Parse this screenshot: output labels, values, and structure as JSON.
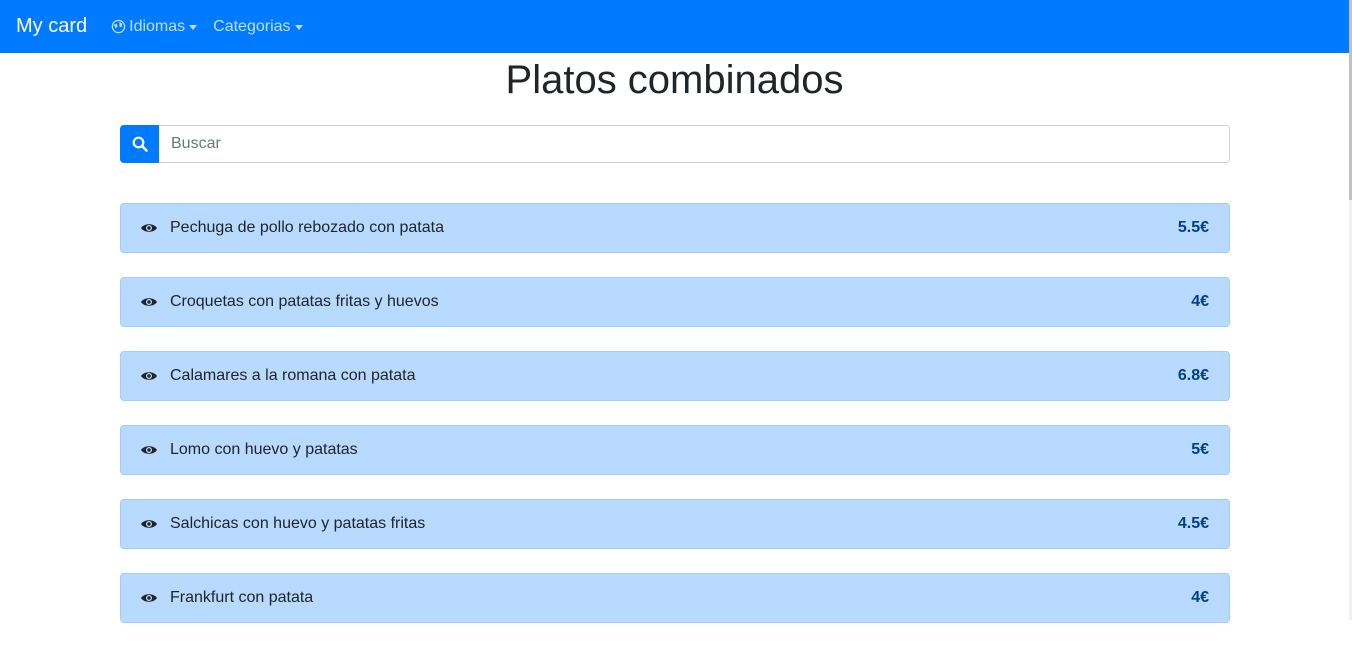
{
  "navbar": {
    "brand": "My card",
    "items": [
      {
        "label": "Idiomas",
        "icon": "globe-icon"
      },
      {
        "label": "Categorias"
      }
    ]
  },
  "page": {
    "title": "Platos combinados"
  },
  "search": {
    "placeholder": "Buscar",
    "value": ""
  },
  "dishes": [
    {
      "name": "Pechuga de pollo rebozado con patata",
      "price": "5.5€"
    },
    {
      "name": "Croquetas con patatas fritas y huevos",
      "price": "4€"
    },
    {
      "name": "Calamares a la romana con patata",
      "price": "6.8€"
    },
    {
      "name": "Lomo con huevo y patatas",
      "price": "5€"
    },
    {
      "name": "Salchicas con huevo y patatas fritas",
      "price": "4.5€"
    },
    {
      "name": "Frankfurt con patata",
      "price": "4€"
    }
  ],
  "colors": {
    "navbar": "#007bff",
    "dish_background": "#b8daff",
    "price_text": "#004085"
  }
}
